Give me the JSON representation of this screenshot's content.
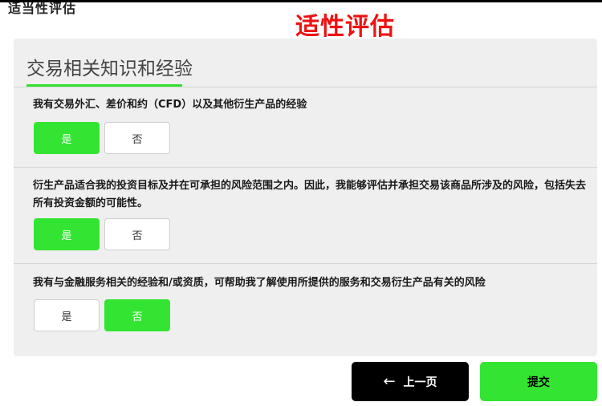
{
  "header": {
    "breadcrumb": "适当性评估",
    "title": "适性评估"
  },
  "section": {
    "title": "交易相关知识和经验"
  },
  "questions": [
    {
      "text": "我有交易外汇、差价和约（CFD）以及其他衍生产品的经验",
      "yes_label": "是",
      "no_label": "否",
      "selected": "yes"
    },
    {
      "text": "衍生产品适合我的投资目标及并在可承担的风险范围之内。因此，我能够评估并承担交易该商品所涉及的风险，包括失去所有投资金额的可能性。",
      "yes_label": "是",
      "no_label": "否",
      "selected": "yes"
    },
    {
      "text": "我有与金融服务相关的经验和/或资质，可帮助我了解使用所提供的服务和交易衍生产品有关的风险",
      "yes_label": "是",
      "no_label": "否",
      "selected": "no"
    }
  ],
  "footer": {
    "prev_label": "上一页",
    "submit_label": "提交"
  },
  "colors": {
    "accent": "#33e532",
    "title": "#ee1111"
  },
  "icons": {
    "prev": "arrow-left-icon"
  }
}
